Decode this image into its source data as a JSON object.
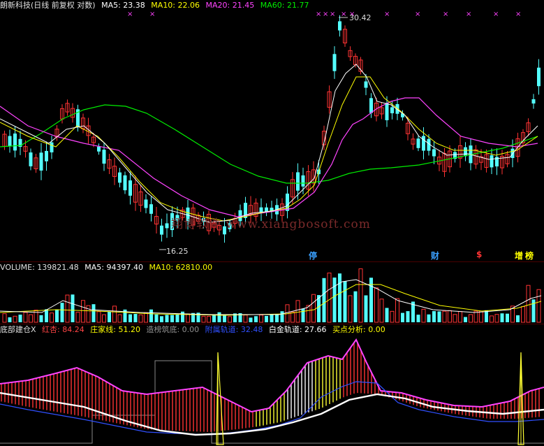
{
  "price_legend": {
    "title": "朗新科技(日线 前复权 对数)",
    "ma5": "MA5: 23.38",
    "ma10": "MA10: 22.06",
    "ma20": "MA20: 21.45",
    "ma60": "MA60: 21.77"
  },
  "price_labels": {
    "peak": "30.42",
    "trough": "16.25",
    "watermark": "翔博软件 www.xiangbosoft.com"
  },
  "event_tags": [
    {
      "text": "停",
      "color": "#3aa0ff"
    },
    {
      "text": "财",
      "color": "#3aa0ff"
    },
    {
      "text": "$",
      "color": "#ff3333"
    },
    {
      "text": "增",
      "color": "#ffff00"
    },
    {
      "text": "榜",
      "color": "#ffff00"
    }
  ],
  "volume_legend": {
    "title": "VOLUME: 139821.48",
    "ma5": "MA5: 94397.40",
    "ma10": "MA10: 62810.00"
  },
  "indicator_legend": {
    "title": "底部建仓X",
    "hongxing": "红杏: 84.24",
    "zhuangjia": "庄家线: 51.20",
    "zaobang": "造榜筑底: 0.00",
    "fuzhu": "附属轨道: 32.48",
    "baijin": "白金轨道: 27.66",
    "maidian": "买点分析: 0.00"
  },
  "colors": {
    "up": "#ff3333",
    "down": "#54ffff",
    "ma5": "#ffffff",
    "ma10": "#ffff00",
    "ma20": "#ff44ff",
    "ma60": "#00ee00",
    "background": "#000000"
  },
  "chart_data": [
    {
      "type": "candlestick",
      "scale": "log",
      "ylim": [
        16.25,
        30.42
      ],
      "highest": 30.42,
      "lowest": 16.25,
      "series": [
        "MA5",
        "MA10",
        "MA20",
        "MA60"
      ]
    },
    {
      "type": "bar",
      "series": [
        "VOLUME",
        "MA5",
        "MA10"
      ],
      "values_last": [
        139821.48,
        94397.4,
        62810.0
      ]
    },
    {
      "type": "area",
      "series": [
        "红杏",
        "庄家线",
        "造榜筑底",
        "附属轨道",
        "白金轨道",
        "买点分析"
      ],
      "values_last": [
        84.24,
        51.2,
        0.0,
        32.48,
        27.66,
        0.0
      ]
    }
  ]
}
